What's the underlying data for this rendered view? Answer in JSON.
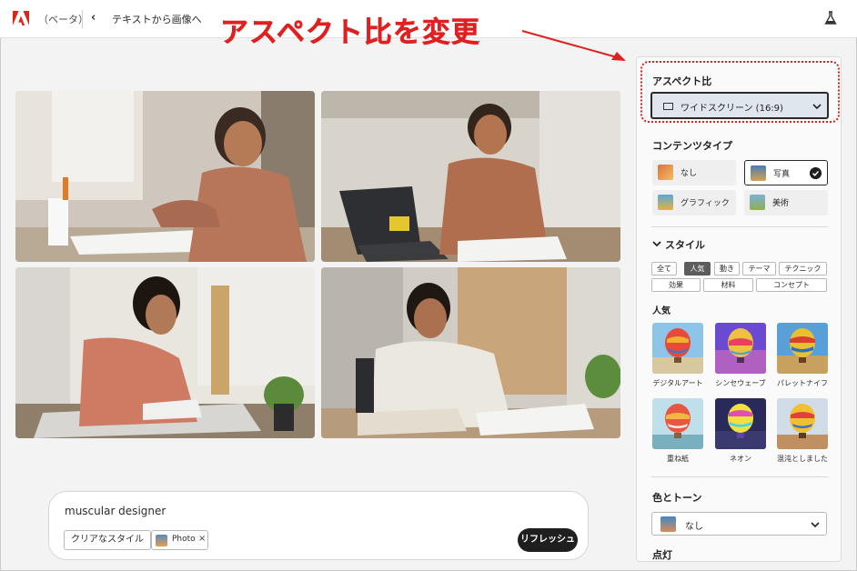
{
  "topbar": {
    "beta_label": "（ベータ）",
    "breadcrumb": "テキストから画像へ"
  },
  "annotation": {
    "title": "アスペクト比を変更",
    "color": "#e02020"
  },
  "images": [
    {
      "description_icon": "photo-designer-1"
    },
    {
      "description_icon": "photo-designer-2"
    },
    {
      "description_icon": "photo-designer-3"
    },
    {
      "description_icon": "photo-designer-4"
    }
  ],
  "prompt": {
    "text": "muscular designer",
    "clear_style_label": "クリアなスタイル",
    "tag_label": "Photo",
    "tag_close": "×",
    "refresh_label": "リフレッシュ"
  },
  "panel": {
    "aspect": {
      "heading": "アスペクト比",
      "value": "ワイドスクリーン (16:9)"
    },
    "content_type": {
      "heading": "コンテンツタイプ",
      "options": [
        {
          "label": "なし",
          "selected": false
        },
        {
          "label": "写真",
          "selected": true
        },
        {
          "label": "グラフィック",
          "selected": false
        },
        {
          "label": "美術",
          "selected": false
        }
      ]
    },
    "style": {
      "heading": "スタイル",
      "chips_row1": [
        "全て",
        "人気",
        "動き",
        "テーマ",
        "テクニック"
      ],
      "chips_row2": [
        "効果",
        "材料",
        "コンセプト"
      ],
      "active_chip": "人気",
      "popular_heading": "人気",
      "tiles": [
        {
          "label": "デジタルアート"
        },
        {
          "label": "シンセウェーブ"
        },
        {
          "label": "パレットナイフ"
        },
        {
          "label": "重ね紙"
        },
        {
          "label": "ネオン"
        },
        {
          "label": "混沌としました"
        }
      ]
    },
    "tone": {
      "heading": "色とトーン",
      "value": "なし"
    },
    "lighting": {
      "heading": "点灯"
    }
  }
}
